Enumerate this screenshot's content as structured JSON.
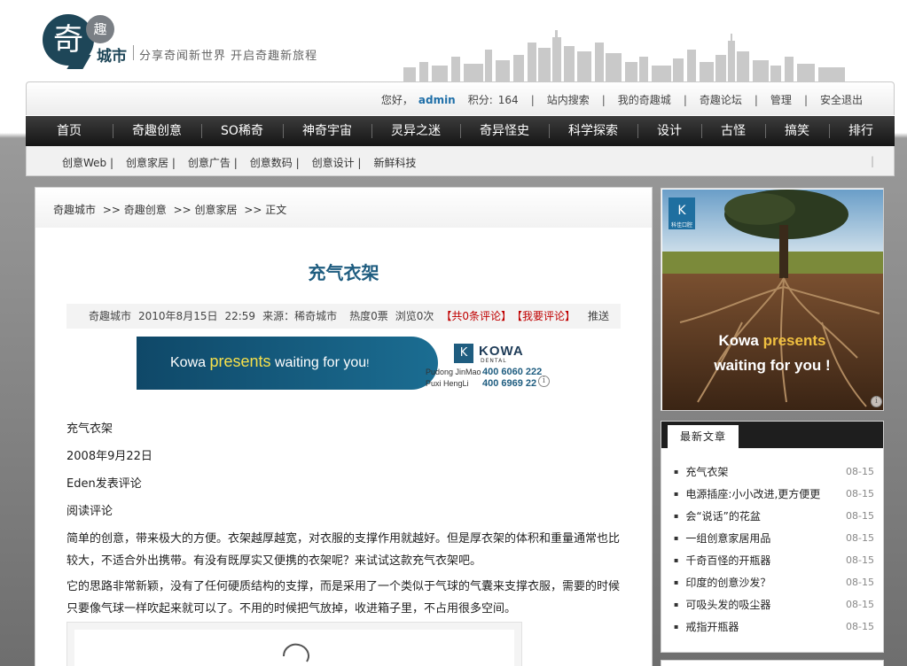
{
  "brand": {
    "logo_main": "奇",
    "logo_small": "趣",
    "logo_city": "城市",
    "slogan": "分享奇闻新世界 开启奇趣新旅程",
    "dark_color": "#1e4658"
  },
  "topbar": {
    "greeting": "您好，",
    "user": "admin",
    "points_label": "积分:",
    "points_value": "164",
    "links": [
      "站内搜索",
      "我的奇趣城",
      "奇趣论坛",
      "管理",
      "安全退出"
    ]
  },
  "mainnav": [
    "首页",
    "奇趣创意",
    "SO稀奇",
    "神奇宇宙",
    "灵异之迷",
    "奇异怪史",
    "科学探索",
    "设计",
    "古怪",
    "搞笑",
    "排行"
  ],
  "subnav": [
    "创意Web |",
    "创意家居 |",
    "创意广告 |",
    "创意数码 |",
    "创意设计 |",
    "新鲜科技"
  ],
  "subnav_end": "|",
  "breadcrumb": [
    "奇趣城市",
    ">> 奇趣创意",
    ">> 创意家居",
    ">> 正文"
  ],
  "article": {
    "title": "充气衣架",
    "meta": {
      "site": "奇趣城市",
      "date": "2010年8月15日",
      "time": "22:59",
      "source": "来源：稀奇城市",
      "heat": "热度0票",
      "views": "浏览0次",
      "comments": "【共0条评论】",
      "my_comment": "【我要评论】",
      "push": "推送"
    },
    "lines": [
      "充气衣架",
      "2008年9月22日",
      "Eden发表评论",
      "阅读评论"
    ],
    "paragraphs": [
      "简单的创意，带来极大的方便。衣架越厚越宽，对衣服的支撑作用就越好。但是厚衣架的体积和重量通常也比较大，不适合外出携带。有没有既厚实又便携的衣架呢？来试试这款充气衣架吧。",
      "它的思路非常新颖，没有了任何硬质结构的支撑，而是采用了一个类似于气球的气囊来支撑衣服，需要的时候只要像气球一样吹起来就可以了。不用的时候把气放掉，收进箱子里，不占用很多空间。"
    ]
  },
  "banner_ad": {
    "text_a": "Kowa",
    "text_b": "presents",
    "text_c": "waiting for you",
    "text_d": "!",
    "brand": "KOWA",
    "brand_sub": "DENTAL",
    "addr1": "Pudong JinMao",
    "phone1": "400 6060 222",
    "addr2": "Puxi HengLi",
    "phone2": "400 6969 22",
    "info_icon": "i",
    "logo_letter": "K"
  },
  "side_ad": {
    "line1_a": "Kowa",
    "line1_b": "presents",
    "line2": "waiting  for  you !",
    "logo_letter": "K",
    "logo_sub": "科佳口腔",
    "info_icon": "i"
  },
  "latest": {
    "title": "最新文章",
    "items": [
      {
        "title": "充气衣架",
        "date": "08-15"
      },
      {
        "title": "电源插座:小小改进,更方便更",
        "date": "08-15"
      },
      {
        "title": "会“说话”的花盆",
        "date": "08-15"
      },
      {
        "title": "一组创意家居用品",
        "date": "08-15"
      },
      {
        "title": "千奇百怪的开瓶器",
        "date": "08-15"
      },
      {
        "title": "印度的创意沙发？",
        "date": "08-15"
      },
      {
        "title": "可吸头发的吸尘器",
        "date": "08-15"
      },
      {
        "title": "戒指开瓶器",
        "date": "08-15"
      }
    ]
  },
  "colors": {
    "title": "#1f5d80",
    "red": "#c00000",
    "admin": "#1f6fa8",
    "nav_bg": "#1b1b1b"
  }
}
